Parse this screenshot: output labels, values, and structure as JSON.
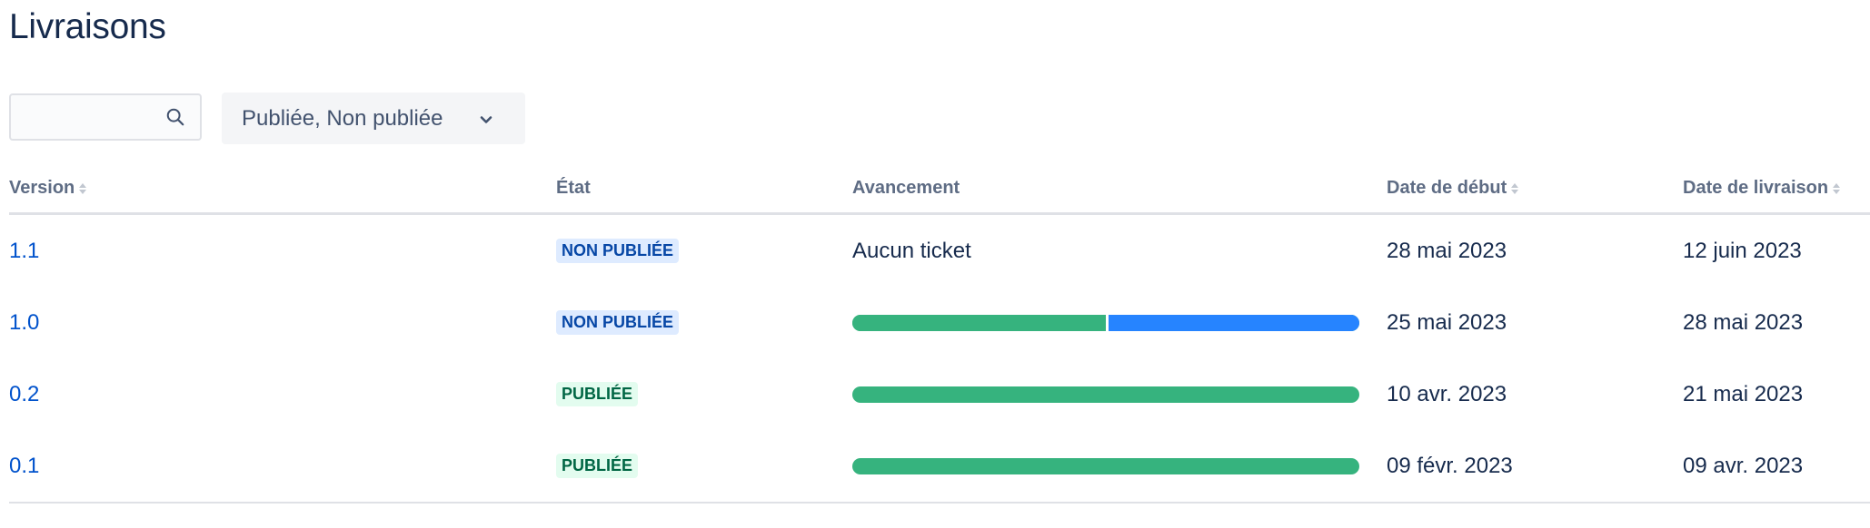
{
  "page": {
    "title": "Livraisons"
  },
  "search": {
    "value": "",
    "placeholder": "",
    "icon": "search-icon"
  },
  "filter": {
    "label": "Publiée, Non publiée",
    "icon": "chevron-down-icon"
  },
  "table": {
    "columns": {
      "version": "Version",
      "status": "État",
      "progress": "Avancement",
      "start_date": "Date de début",
      "release_date": "Date de livraison"
    },
    "rows": [
      {
        "version": "1.1",
        "status": "NON PUBLIÉE",
        "status_type": "unreleased",
        "progress_text": "Aucun ticket",
        "progress_done_fraction": null,
        "start_date": "28 mai 2023",
        "release_date": "12 juin 2023"
      },
      {
        "version": "1.0",
        "status": "NON PUBLIÉE",
        "status_type": "unreleased",
        "progress_text": "",
        "progress_done_fraction": 0.5,
        "start_date": "25 mai 2023",
        "release_date": "28 mai 2023"
      },
      {
        "version": "0.2",
        "status": "PUBLIÉE",
        "status_type": "released",
        "progress_text": "",
        "progress_done_fraction": 1.0,
        "start_date": "10 avr. 2023",
        "release_date": "21 mai 2023"
      },
      {
        "version": "0.1",
        "status": "PUBLIÉE",
        "status_type": "released",
        "progress_text": "",
        "progress_done_fraction": 1.0,
        "start_date": "09 févr. 2023",
        "release_date": "09 avr. 2023"
      }
    ]
  },
  "colors": {
    "done": "#36b37e",
    "in_progress": "#2684ff",
    "link": "#0052cc",
    "unreleased_bg": "#deebff",
    "unreleased_text": "#0747a6",
    "released_bg": "#e3fcef",
    "released_text": "#006644"
  }
}
